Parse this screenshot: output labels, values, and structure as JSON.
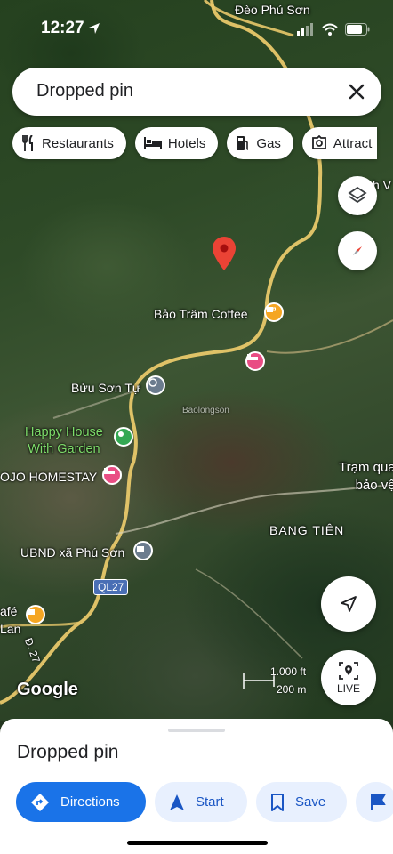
{
  "status_bar": {
    "time": "12:27"
  },
  "search": {
    "text": "Dropped pin"
  },
  "chips": [
    {
      "label": "Restaurants",
      "icon": "fork-knife-icon"
    },
    {
      "label": "Hotels",
      "icon": "bed-icon"
    },
    {
      "label": "Gas",
      "icon": "gas-pump-icon"
    },
    {
      "label": "Attract",
      "icon": "camera-icon"
    }
  ],
  "map_labels": {
    "deo_phu_son": "Đèo Phú Sơn",
    "bao_tram": "Bảo Trâm Coffee",
    "buu_son_tu": "Bửu Sơn Tự",
    "happy_house": "Happy House\nWith Garden",
    "ojo": "OJO HOMESTAY",
    "tram_qua": "Trạm qua\nbảo vệ",
    "bang_tien": "BANG TIÊN",
    "ubnd": "UBND xã Phú Sơn",
    "ql27": "QL27",
    "cafe_lan": "afé\nLan",
    "d27": "Đ. 27",
    "ch_v": "ch V",
    "watermark": "Baolongson",
    "google": "Google"
  },
  "scale": {
    "ft": "1.000 ft",
    "m": "200 m"
  },
  "live_label": "LIVE",
  "sheet": {
    "title": "Dropped pin",
    "actions": [
      {
        "label": "Directions",
        "icon": "directions-icon"
      },
      {
        "label": "Start",
        "icon": "navigation-arrow-icon"
      },
      {
        "label": "Save",
        "icon": "bookmark-icon"
      },
      {
        "label": "",
        "icon": "flag-icon"
      }
    ]
  },
  "colors": {
    "road": "#e8c86a",
    "pin": "#ea4335",
    "hotel_poi": "#e94d84",
    "cafe_poi": "#f5a623",
    "primary": "#1a73e8",
    "chip_bg": "#e8f0fe"
  }
}
